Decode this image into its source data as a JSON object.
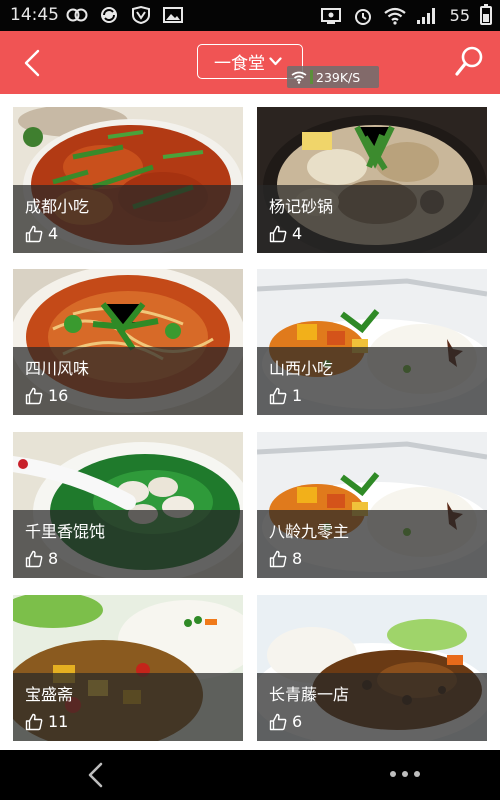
{
  "status_bar": {
    "time": "14:45",
    "battery": "55",
    "icons": [
      "link-icon",
      "sync-icon",
      "shield-icon",
      "image-icon",
      "screen-cast-icon",
      "alarm-icon",
      "wifi-icon",
      "signal-icon"
    ]
  },
  "header": {
    "title": "一食堂",
    "network_speed": "239K/S",
    "background_color": "#f05454"
  },
  "restaurants": [
    {
      "name": "成都小吃",
      "likes": "4"
    },
    {
      "name": "杨记砂锅",
      "likes": "4"
    },
    {
      "name": "四川风味",
      "likes": "16"
    },
    {
      "name": "山西小吃",
      "likes": "1"
    },
    {
      "name": "千里香馄饨",
      "likes": "8"
    },
    {
      "name": "八龄九零主",
      "likes": "8"
    },
    {
      "name": "宝盛斋",
      "likes": "11"
    },
    {
      "name": "长青藤一店",
      "likes": "6"
    }
  ]
}
